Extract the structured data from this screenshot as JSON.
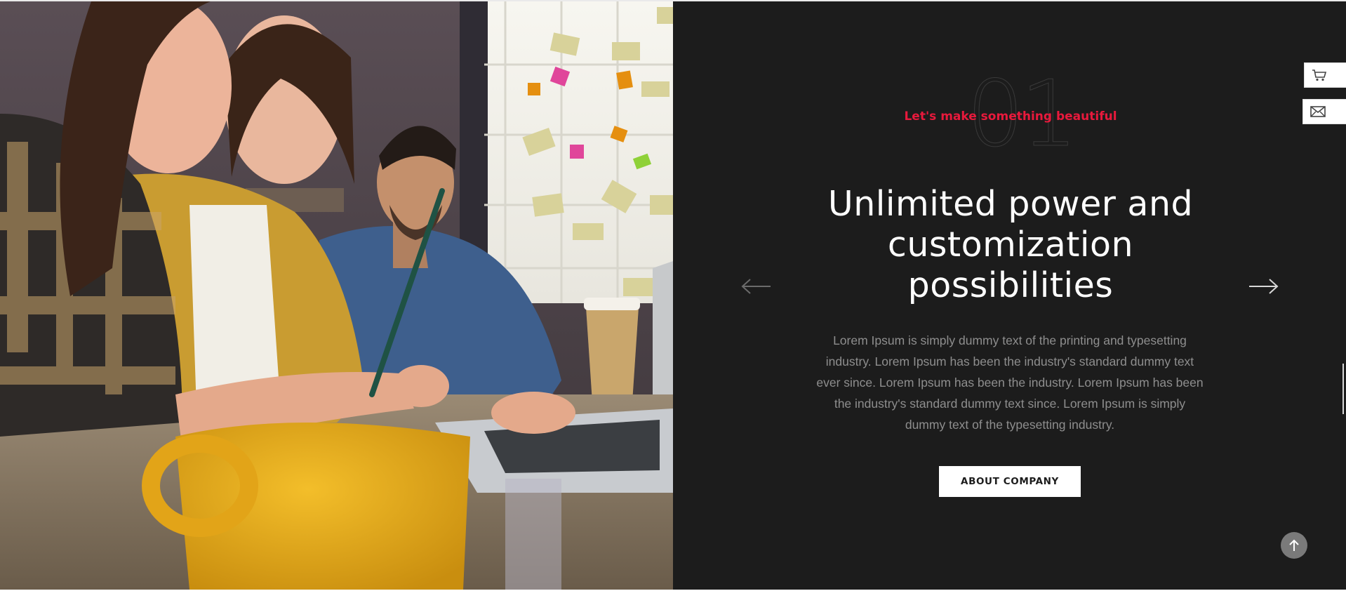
{
  "slide": {
    "number": "01",
    "tagline": "Let's make something beautiful",
    "headline": "Unlimited power and customization possibilities",
    "body": "Lorem Ipsum is simply dummy text of the printing and typesetting industry. Lorem Ipsum has been the industry's standard dummy text ever since. Lorem Ipsum has been the industry. Lorem Ipsum has been the industry's standard dummy text since. Lorem Ipsum is simply dummy text of the typesetting industry.",
    "cta_label": "ABOUT COMPANY"
  },
  "photo": {
    "subject": "team-working-at-table"
  },
  "navigation": {
    "prev_icon": "arrow-left-icon",
    "next_icon": "arrow-right-icon"
  },
  "side_widgets": {
    "cart_icon": "cart-icon",
    "mail_icon": "mail-icon"
  },
  "back_to_top_icon": "arrow-up-icon",
  "colors": {
    "accent": "#e8193c",
    "panel_bg": "#1c1c1c",
    "headline": "#ffffff",
    "body_text": "#8e8e8e",
    "button_bg": "#ffffff"
  }
}
